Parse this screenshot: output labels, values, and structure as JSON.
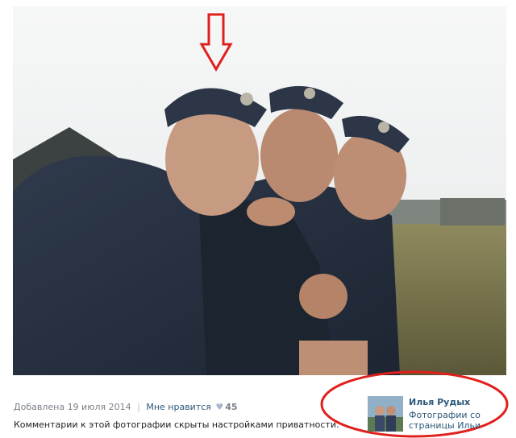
{
  "photo": {
    "icon": "photo-image"
  },
  "meta": {
    "added_label": "Добавлена",
    "date": "19 июля 2014",
    "separator": "|",
    "like_label": "Мне нравится",
    "like_icon": "heart-icon",
    "like_count": "45"
  },
  "notice": {
    "text": "Комментарии к этой фотографии скрыты настройками приватности."
  },
  "owner": {
    "name": "Илья Рудых",
    "source": "Фотографии со страницы Ильи"
  },
  "annotations": {
    "arrow_color": "#e0201c",
    "circle_color": "#e0201c"
  }
}
